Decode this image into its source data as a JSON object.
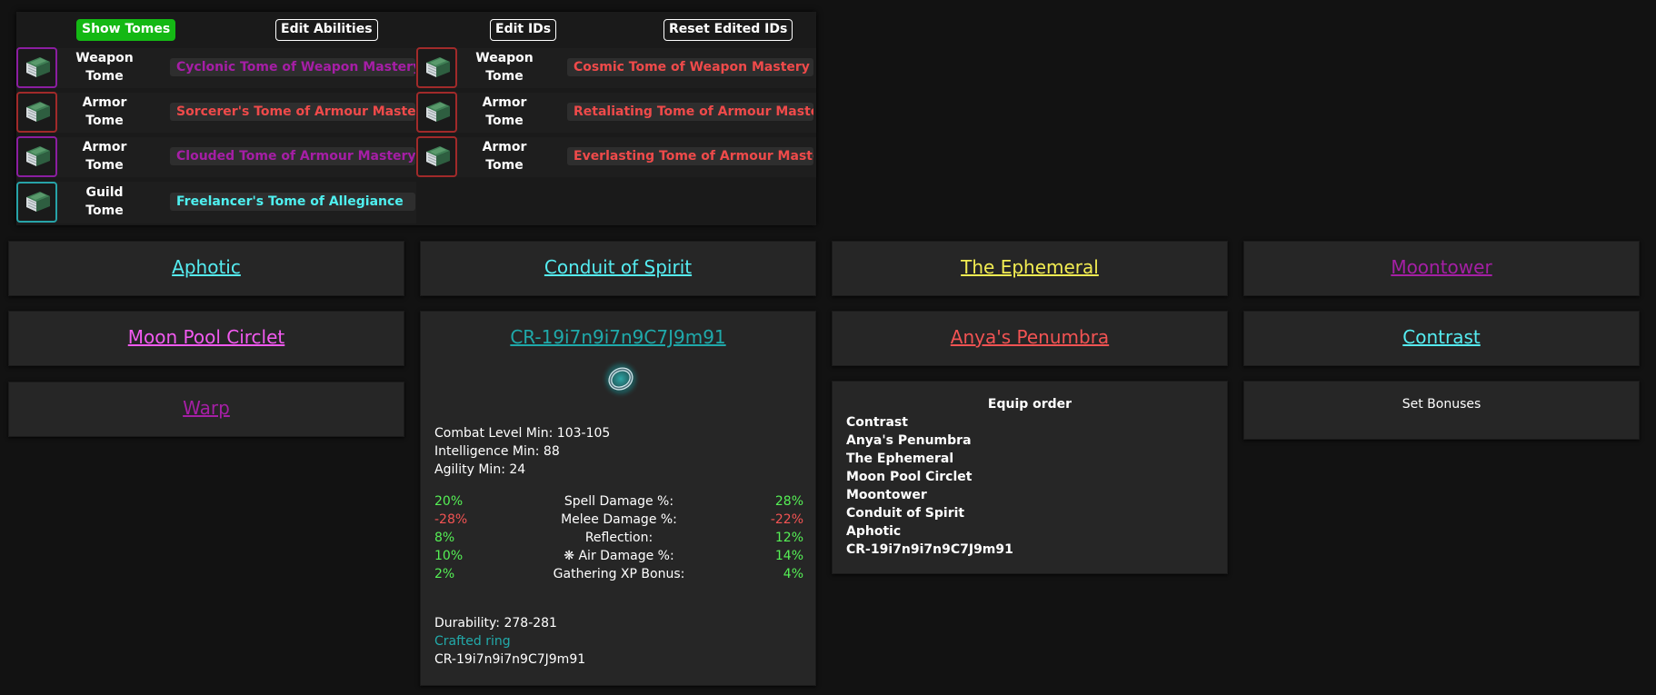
{
  "toolbar": {
    "show_tomes": "Show Tomes",
    "edit_abilities": "Edit Abilities",
    "edit_ids": "Edit IDs",
    "reset_ids": "Reset Edited IDs"
  },
  "tomes": [
    {
      "type_line1": "Weapon",
      "type_line2": "Tome",
      "name": "Cyclonic Tome of Weapon Mastery II",
      "color": "#a61ea6",
      "icon": "book-icon"
    },
    {
      "type_line1": "Weapon",
      "type_line2": "Tome",
      "name": "Cosmic Tome of Weapon Mastery II",
      "color": "#ef4a4a",
      "icon": "book-icon"
    },
    {
      "type_line1": "Armor",
      "type_line2": "Tome",
      "name": "Sorcerer's Tome of Armour Mastery II",
      "color": "#ef4a4a",
      "icon": "book-icon"
    },
    {
      "type_line1": "Armor",
      "type_line2": "Tome",
      "name": "Retaliating Tome of Armour Mastery II",
      "color": "#ef4a4a",
      "icon": "book-icon"
    },
    {
      "type_line1": "Armor",
      "type_line2": "Tome",
      "name": "Clouded Tome of Armour Mastery II",
      "color": "#a61ea6",
      "icon": "book-icon"
    },
    {
      "type_line1": "Armor",
      "type_line2": "Tome",
      "name": "Everlasting Tome of Armour Mastery I",
      "color": "#ef4a4a",
      "icon": "book-icon"
    },
    {
      "type_line1": "Guild",
      "type_line2": "Tome",
      "name": "Freelancer's Tome of Allegiance",
      "color": "#4ff0f0",
      "icon": "book-icon"
    }
  ],
  "equipment": {
    "helmet": "Aphotic",
    "chestplate": "Conduit of Spirit",
    "leggings": "The Ephemeral",
    "boots": "Moontower",
    "ring1": "Moon Pool Circlet",
    "ring2": "CR-19i7n9i7n9C7J9m91",
    "bracelet": "Anya's Penumbra",
    "necklace": "Contrast",
    "weapon": "Warp"
  },
  "crafted": {
    "name": "CR-19i7n9i7n9C7J9m91",
    "icon": "ring-icon",
    "requirements": [
      "Combat Level Min: 103-105",
      "Intelligence Min: 88",
      "Agility Min: 24"
    ],
    "stats": [
      {
        "min": "20%",
        "name": "Spell Damage %:",
        "max": "28%",
        "positive": true
      },
      {
        "min": "-28%",
        "name": "Melee Damage %:",
        "max": "-22%",
        "positive": false
      },
      {
        "min": "8%",
        "name": "Reflection:",
        "max": "12%",
        "positive": true
      },
      {
        "min": "10%",
        "name": "❋ Air Damage %:",
        "max": "14%",
        "positive": true
      },
      {
        "min": "2%",
        "name": "Gathering XP Bonus:",
        "max": "4%",
        "positive": true
      }
    ],
    "durability": "Durability: 278-281",
    "type_label": "Crafted ring",
    "hash": "CR-19i7n9i7n9C7J9m91"
  },
  "equip_order": {
    "title": "Equip order",
    "items": [
      "Contrast",
      "Anya's Penumbra",
      "The Ephemeral",
      "Moon Pool Circlet",
      "Moontower",
      "Conduit of Spirit",
      "Aphotic",
      "CR-19i7n9i7n9C7J9m91"
    ]
  },
  "set_bonuses": {
    "title": "Set Bonuses"
  },
  "colors": {
    "background": "#121212",
    "card": "#262626",
    "fabled_tome": "#a61ea6",
    "legendary_tome": "#ef4a4a",
    "set_tome": "#4ff0f0",
    "positive": "#55f055",
    "negative": "#f25353",
    "active_button": "#14b814"
  }
}
